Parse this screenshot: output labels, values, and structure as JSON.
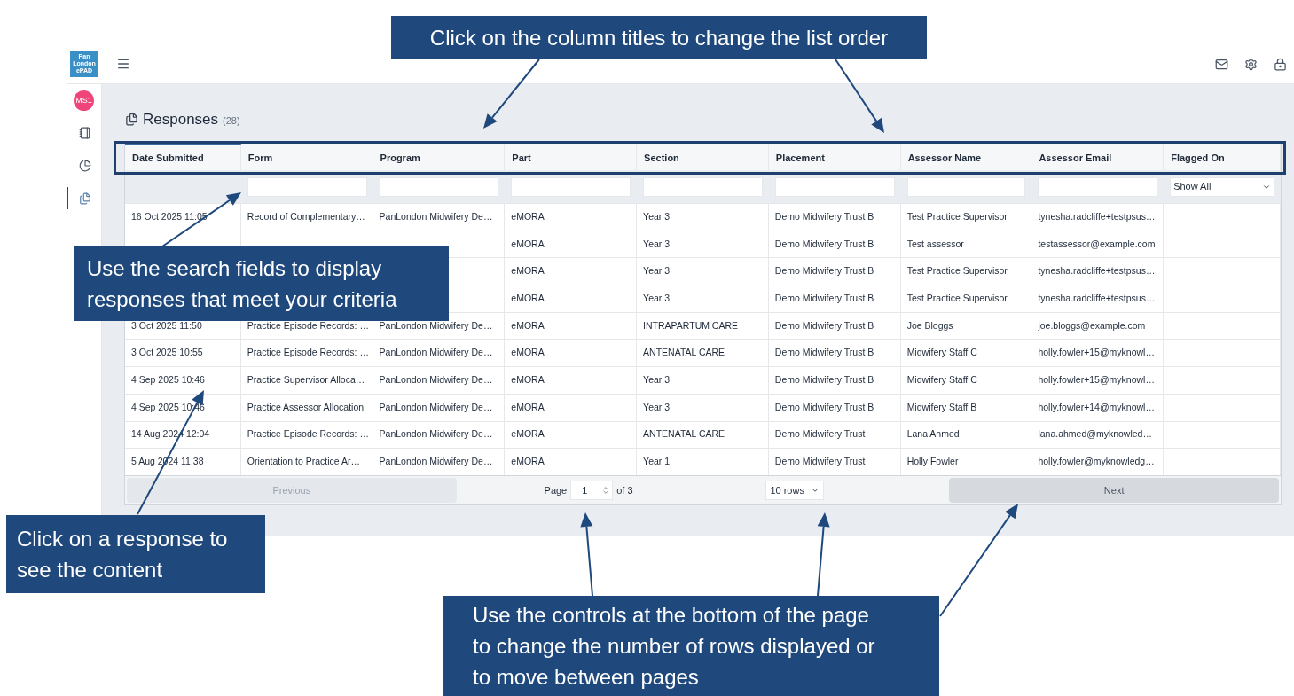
{
  "header": {
    "logo_text": "Pan London ePAD"
  },
  "sidebar": {
    "avatar": "MS1",
    "items": [
      {
        "kind": "notebook",
        "selected": false
      },
      {
        "kind": "chart",
        "selected": false
      },
      {
        "kind": "responses",
        "selected": true
      }
    ]
  },
  "page": {
    "title": "Responses",
    "count": "(28)"
  },
  "table": {
    "columns": [
      {
        "label": "Date Submitted",
        "sorted": true,
        "kind": "none"
      },
      {
        "label": "Form",
        "sorted": false,
        "kind": "text"
      },
      {
        "label": "Program",
        "sorted": false,
        "kind": "text"
      },
      {
        "label": "Part",
        "sorted": false,
        "kind": "text"
      },
      {
        "label": "Section",
        "sorted": false,
        "kind": "text"
      },
      {
        "label": "Placement",
        "sorted": false,
        "kind": "text"
      },
      {
        "label": "Assessor Name",
        "sorted": false,
        "kind": "text"
      },
      {
        "label": "Assessor Email",
        "sorted": false,
        "kind": "text"
      },
      {
        "label": "Flagged On",
        "sorted": false,
        "kind": "select",
        "value": "Show All"
      }
    ],
    "rows": [
      [
        "16 Oct 2025 11:05",
        "Record of Complementary…",
        "PanLondon Midwifery De…",
        "eMORA",
        "Year 3",
        "Demo Midwifery Trust B",
        "Test Practice Supervisor",
        "tynesha.radcliffe+testpsus…",
        null
      ],
      [
        null,
        null,
        null,
        "eMORA",
        "Year 3",
        "Demo Midwifery Trust B",
        "Test assessor",
        "testassessor@example.com",
        null
      ],
      [
        null,
        null,
        null,
        "eMORA",
        "Year 3",
        "Demo Midwifery Trust B",
        "Test Practice Supervisor",
        "tynesha.radcliffe+testpsus…",
        null
      ],
      [
        null,
        null,
        null,
        "eMORA",
        "Year 3",
        "Demo Midwifery Trust B",
        "Test Practice Supervisor",
        "tynesha.radcliffe+testpsus…",
        null
      ],
      [
        "3 Oct 2025 11:50",
        "Practice Episode Records: …",
        "PanLondon Midwifery De…",
        "eMORA",
        "INTRAPARTUM CARE",
        "Demo Midwifery Trust B",
        "Joe Bloggs",
        "joe.bloggs@example.com",
        null
      ],
      [
        "3 Oct 2025 10:55",
        "Practice Episode Records: …",
        "PanLondon Midwifery De…",
        "eMORA",
        "ANTENATAL CARE",
        "Demo Midwifery Trust B",
        "Midwifery Staff C",
        "holly.fowler+15@myknowl…",
        null
      ],
      [
        "4 Sep 2025 10:46",
        "Practice Supervisor Alloca…",
        "PanLondon Midwifery De…",
        "eMORA",
        "Year 3",
        "Demo Midwifery Trust B",
        "Midwifery Staff C",
        "holly.fowler+15@myknowl…",
        null
      ],
      [
        "4 Sep 2025 10:46",
        "Practice Assessor Allocation",
        "PanLondon Midwifery De…",
        "eMORA",
        "Year 3",
        "Demo Midwifery Trust B",
        "Midwifery Staff B",
        "holly.fowler+14@myknowl…",
        null
      ],
      [
        "14 Aug 2024 12:04",
        "Practice Episode Records: …",
        "PanLondon Midwifery De…",
        "eMORA",
        "ANTENATAL CARE",
        "Demo Midwifery Trust",
        "Lana Ahmed",
        "lana.ahmed@myknowled…",
        null
      ],
      [
        "5 Aug 2024 11:38",
        "Orientation to Practice Ar…",
        "PanLondon Midwifery De…",
        "eMORA",
        "Year 1",
        "Demo Midwifery Trust",
        "Holly Fowler",
        "holly.fowler@myknowledg…",
        null
      ]
    ]
  },
  "pagination": {
    "previous": {
      "label": "Previous",
      "disabled": true
    },
    "page_label": "Page",
    "page": "1",
    "of": "of 3",
    "rows": "10 rows",
    "next": {
      "label": "Next",
      "disabled": false
    }
  },
  "callouts": [
    {
      "lines": [
        "Click on the column titles to change the list order"
      ]
    },
    {
      "lines": [
        "Use the search fields to display",
        "responses that meet your criteria"
      ]
    },
    {
      "lines": [
        "Click on a response to",
        "see the content"
      ]
    },
    {
      "lines": [
        "Use the controls at the bottom of the page",
        "to change the number of rows displayed or",
        "to move between pages"
      ]
    }
  ]
}
